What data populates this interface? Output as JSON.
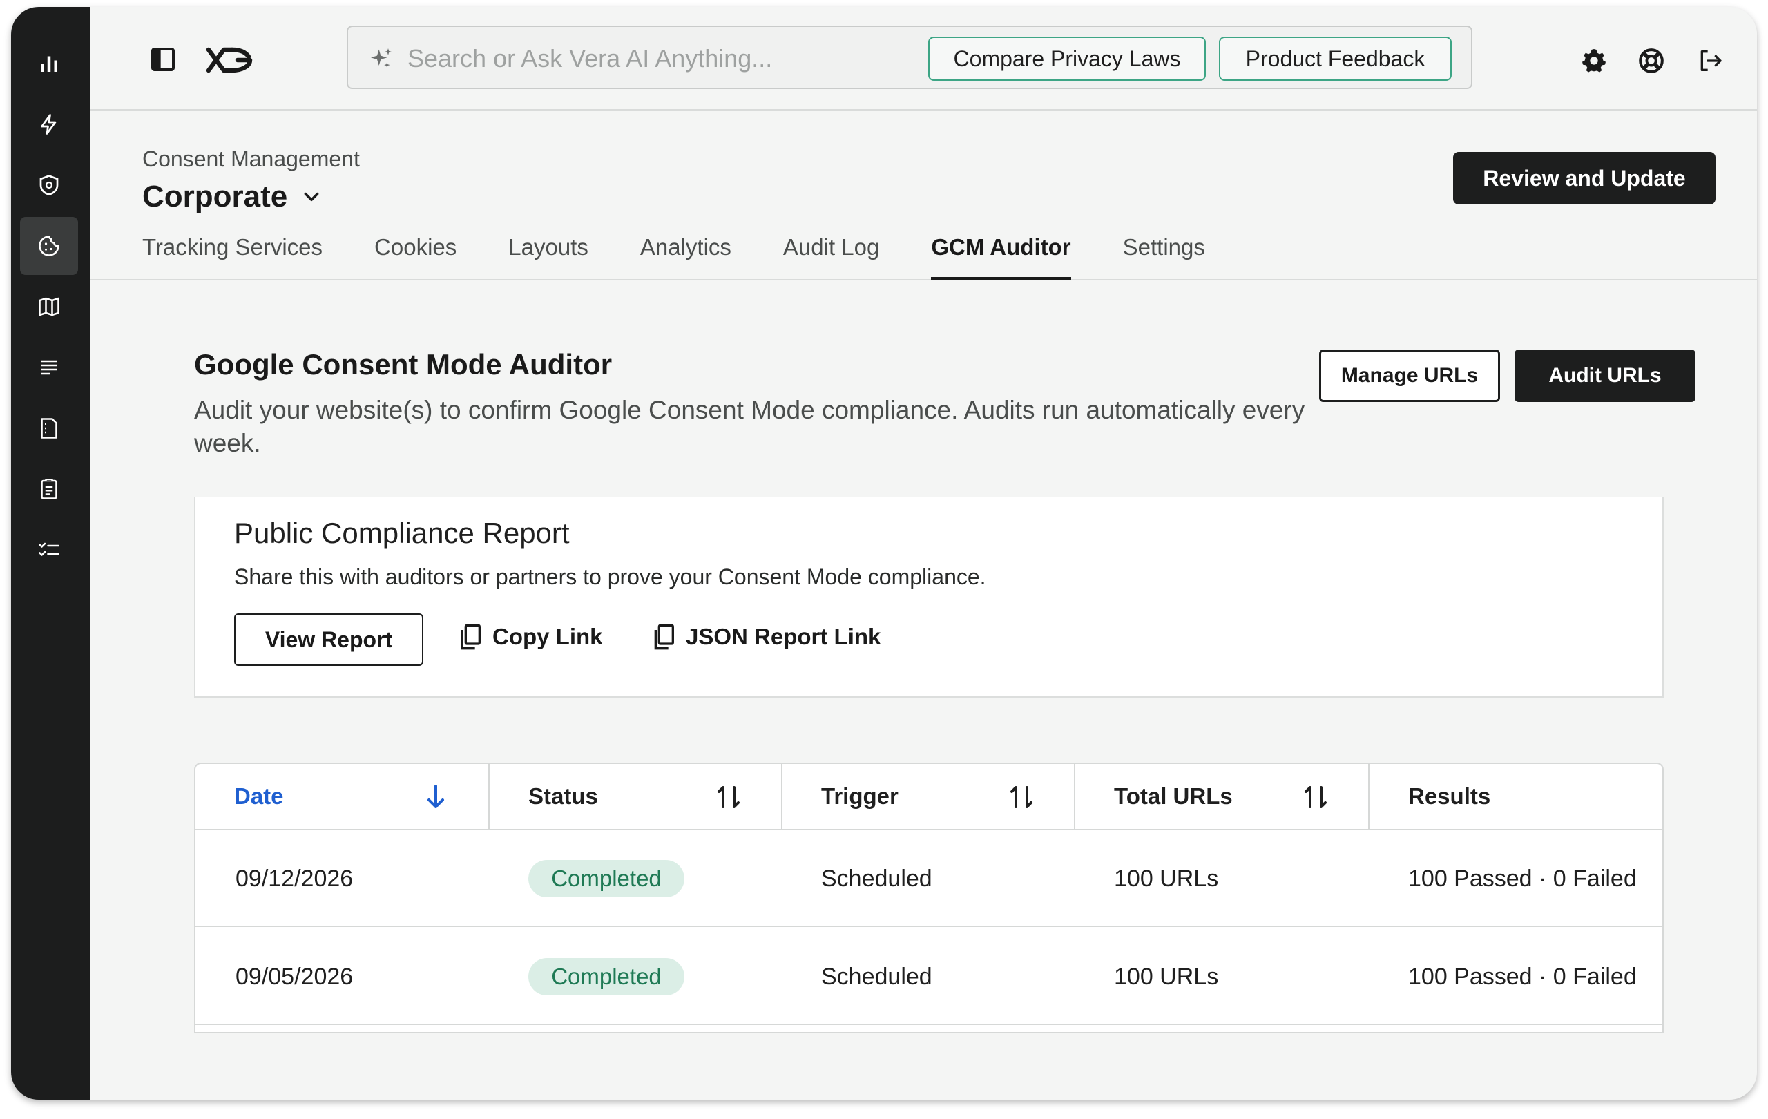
{
  "topbar": {
    "search_placeholder": "Search or Ask Vera AI Anything...",
    "chips": [
      "Compare Privacy Laws",
      "Product Feedback"
    ]
  },
  "header": {
    "breadcrumb": "Consent Management",
    "org_name": "Corporate",
    "primary_action": "Review and Update",
    "tabs": [
      "Tracking Services",
      "Cookies",
      "Layouts",
      "Analytics",
      "Audit Log",
      "GCM Auditor",
      "Settings"
    ],
    "active_tab": "GCM Auditor"
  },
  "section": {
    "title": "Google Consent Mode Auditor",
    "description": "Audit your website(s) to confirm Google Consent Mode compliance. Audits run automatically every week.",
    "manage_button": "Manage URLs",
    "audit_button": "Audit URLs"
  },
  "report_card": {
    "title": "Public Compliance Report",
    "description": "Share this with auditors or partners to prove your Consent Mode compliance.",
    "view_button": "View Report",
    "copy_link": "Copy Link",
    "json_link": "JSON Report Link"
  },
  "table": {
    "columns": [
      "Date",
      "Status",
      "Trigger",
      "Total URLs",
      "Results"
    ],
    "rows": [
      {
        "date": "09/12/2026",
        "status": "Completed",
        "trigger": "Scheduled",
        "total": "100 URLs",
        "results": "100 Passed · 0 Failed"
      },
      {
        "date": "09/05/2026",
        "status": "Completed",
        "trigger": "Scheduled",
        "total": "100 URLs",
        "results": "100 Passed · 0 Failed"
      }
    ]
  },
  "colors": {
    "rail_bg": "#1c1d1d",
    "primary_dark": "#1d1e1e",
    "accent_green": "#3da585",
    "badge_bg": "#dbeee6",
    "badge_text": "#1f7a55",
    "sort_active": "#1f5fd0"
  },
  "icons": {
    "rail": [
      "bar-chart-icon",
      "lightning-icon",
      "shield-at-icon",
      "cookie-icon",
      "map-icon",
      "list-icon",
      "document-icon",
      "clipboard-icon",
      "checklist-icon"
    ],
    "top": [
      "sidebar-toggle-icon",
      "logo-icon",
      "sparkle-icon",
      "gear-icon",
      "lifebuoy-icon",
      "logout-icon"
    ]
  }
}
